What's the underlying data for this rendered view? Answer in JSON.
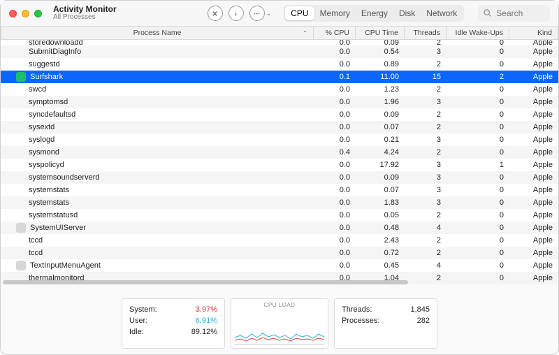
{
  "window": {
    "title": "Activity Monitor",
    "subtitle": "All Processes"
  },
  "search": {
    "placeholder": "Search"
  },
  "tabs": [
    {
      "label": "CPU",
      "active": true
    },
    {
      "label": "Memory",
      "active": false
    },
    {
      "label": "Energy",
      "active": false
    },
    {
      "label": "Disk",
      "active": false
    },
    {
      "label": "Network",
      "active": false
    }
  ],
  "columns": {
    "name": "Process Name",
    "cpu": "% CPU",
    "time": "CPU Time",
    "threads": "Threads",
    "wakes": "Idle Wake-Ups",
    "kind": "Kind"
  },
  "rows": [
    {
      "name": "storedownloadd",
      "cpu": "0.0",
      "time": "0.09",
      "threads": "2",
      "wakes": "0",
      "kind": "Apple",
      "cut": true
    },
    {
      "name": "SubmitDiagInfo",
      "cpu": "0.0",
      "time": "0.54",
      "threads": "3",
      "wakes": "0",
      "kind": "Apple"
    },
    {
      "name": "suggestd",
      "cpu": "0.0",
      "time": "0.89",
      "threads": "2",
      "wakes": "0",
      "kind": "Apple"
    },
    {
      "name": "Surfshark",
      "cpu": "0.1",
      "time": "11.00",
      "threads": "15",
      "wakes": "2",
      "kind": "Apple",
      "selected": true,
      "icon": "green"
    },
    {
      "name": "swcd",
      "cpu": "0.0",
      "time": "1.23",
      "threads": "2",
      "wakes": "0",
      "kind": "Apple"
    },
    {
      "name": "symptomsd",
      "cpu": "0.0",
      "time": "1.96",
      "threads": "3",
      "wakes": "0",
      "kind": "Apple"
    },
    {
      "name": "syncdefaultsd",
      "cpu": "0.0",
      "time": "0.09",
      "threads": "2",
      "wakes": "0",
      "kind": "Apple"
    },
    {
      "name": "sysextd",
      "cpu": "0.0",
      "time": "0.07",
      "threads": "2",
      "wakes": "0",
      "kind": "Apple"
    },
    {
      "name": "syslogd",
      "cpu": "0.0",
      "time": "0.21",
      "threads": "3",
      "wakes": "0",
      "kind": "Apple"
    },
    {
      "name": "sysmond",
      "cpu": "0.4",
      "time": "4.24",
      "threads": "2",
      "wakes": "0",
      "kind": "Apple"
    },
    {
      "name": "syspolicyd",
      "cpu": "0.0",
      "time": "17.92",
      "threads": "3",
      "wakes": "1",
      "kind": "Apple"
    },
    {
      "name": "systemsoundserverd",
      "cpu": "0.0",
      "time": "0.09",
      "threads": "3",
      "wakes": "0",
      "kind": "Apple"
    },
    {
      "name": "systemstats",
      "cpu": "0.0",
      "time": "0.07",
      "threads": "3",
      "wakes": "0",
      "kind": "Apple"
    },
    {
      "name": "systemstats",
      "cpu": "0.0",
      "time": "1.83",
      "threads": "3",
      "wakes": "0",
      "kind": "Apple"
    },
    {
      "name": "systemstatusd",
      "cpu": "0.0",
      "time": "0.05",
      "threads": "2",
      "wakes": "0",
      "kind": "Apple"
    },
    {
      "name": "SystemUIServer",
      "cpu": "0.0",
      "time": "0.48",
      "threads": "4",
      "wakes": "0",
      "kind": "Apple",
      "icon": "gray"
    },
    {
      "name": "tccd",
      "cpu": "0.0",
      "time": "2.43",
      "threads": "2",
      "wakes": "0",
      "kind": "Apple"
    },
    {
      "name": "tccd",
      "cpu": "0.0",
      "time": "0.72",
      "threads": "2",
      "wakes": "0",
      "kind": "Apple"
    },
    {
      "name": "TextInputMenuAgent",
      "cpu": "0.0",
      "time": "0.45",
      "threads": "4",
      "wakes": "0",
      "kind": "Apple",
      "icon": "gray"
    },
    {
      "name": "thermalmonitord",
      "cpu": "0.0",
      "time": "1.04",
      "threads": "2",
      "wakes": "0",
      "kind": "Apple",
      "cut": true
    }
  ],
  "footer": {
    "stats": {
      "system_label": "System:",
      "system": "3.97%",
      "user_label": "User:",
      "user": "6.91%",
      "idle_label": "Idle:",
      "idle": "89.12%"
    },
    "load_title": "CPU LOAD",
    "threads": {
      "label": "Threads:",
      "value": "1,845",
      "proc_label": "Processes:",
      "proc_value": "282"
    }
  }
}
